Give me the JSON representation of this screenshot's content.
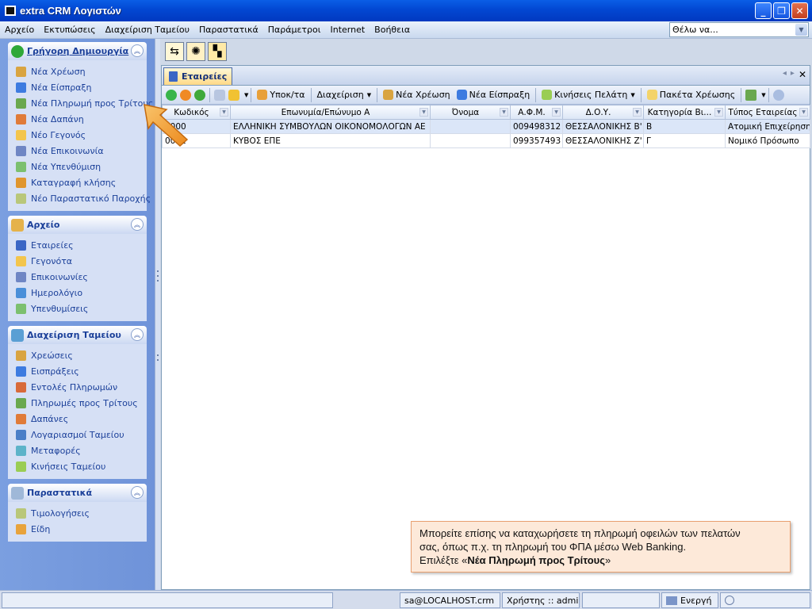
{
  "window": {
    "title": "extra CRM Λογιστών"
  },
  "menubar": {
    "items": [
      "Αρχείο",
      "Εκτυπώσεις",
      "Διαχείριση Ταμείου",
      "Παραστατικά",
      "Παράμετροι",
      "Internet",
      "Βοήθεια"
    ],
    "search_value": "Θέλω να..."
  },
  "sidebar": {
    "groups": [
      {
        "title": "Γρήγορη Δημιουργία",
        "items": [
          "Νέα Χρέωση",
          "Νέα Είσπραξη",
          "Νέα Πληρωμή προς Τρίτους",
          "Νέα Δαπάνη",
          "Νέο Γεγονός",
          "Νέα Επικοινωνία",
          "Νέα Υπενθύμιση",
          "Καταγραφή κλήσης",
          "Νέο Παραστατικό Παροχής"
        ]
      },
      {
        "title": "Αρχείο",
        "items": [
          "Εταιρείες",
          "Γεγονότα",
          "Επικοινωνίες",
          "Ημερολόγιο",
          "Υπενθυμίσεις"
        ]
      },
      {
        "title": "Διαχείριση Ταμείου",
        "items": [
          "Χρεώσεις",
          "Εισπράξεις",
          "Εντολές Πληρωμών",
          "Πληρωμές προς Τρίτους",
          "Δαπάνες",
          "Λογαριασμοί Ταμείου",
          "Μεταφορές",
          "Κινήσεις Ταμείου"
        ]
      },
      {
        "title": "Παραστατικά",
        "items": [
          "Τιμολογήσεις",
          "Είδη"
        ]
      }
    ]
  },
  "document": {
    "tab_label": "Εταιρείες",
    "toolbar": {
      "ypokta": "Υποκ/τα",
      "diaxeirisi": "Διαχείριση",
      "nea_xreosi": "Νέα Χρέωση",
      "nea_eispraxi": "Νέα Είσπραξη",
      "kiniseis_pelati": "Κινήσεις Πελάτη",
      "paketa_xreosis": "Πακέτα Χρέωσης"
    },
    "columns": [
      "Κωδικός",
      "Επωνυμία/Επώνυμο Α",
      "Όνομα",
      "Α.Φ.Μ.",
      "Δ.Ο.Υ.",
      "Κατηγορία Βι...",
      "Τύπος Εταιρείας"
    ],
    "rows": [
      [
        "0000",
        "ΕΛΛΗΝΙΚΗ ΣΥΜΒΟΥΛΩΝ ΟΙΚΟΝΟΜΟΛΟΓΩΝ ΑΕ",
        "",
        "009498312",
        "ΘΕΣΣΑΛΟΝΙΚΗΣ Β'",
        "Β",
        "Ατομική Επιχείρηση"
      ],
      [
        "0001",
        "ΚΥΒΟΣ ΕΠΕ",
        "",
        "099357493",
        "ΘΕΣΣΑΛΟΝΙΚΗΣ Ζ'",
        "Γ",
        "Νομικό Πρόσωπο"
      ]
    ]
  },
  "statusbar": {
    "user_host": "sa@LOCALHOST.crm",
    "user": "Χρήστης :: admin",
    "status": "Ενεργή"
  },
  "callout": {
    "line1": "Μπορείτε επίσης να καταχωρήσετε τη πληρωμή οφειλών των πελατών",
    "line2": "σας, όπως π.χ. τη πληρωμή του ΦΠΑ μέσω Web Banking.",
    "line3_prefix": "Επιλέξτε «",
    "line3_bold": "Νέα Πληρωμή προς Τρίτους",
    "line3_suffix": "»"
  }
}
